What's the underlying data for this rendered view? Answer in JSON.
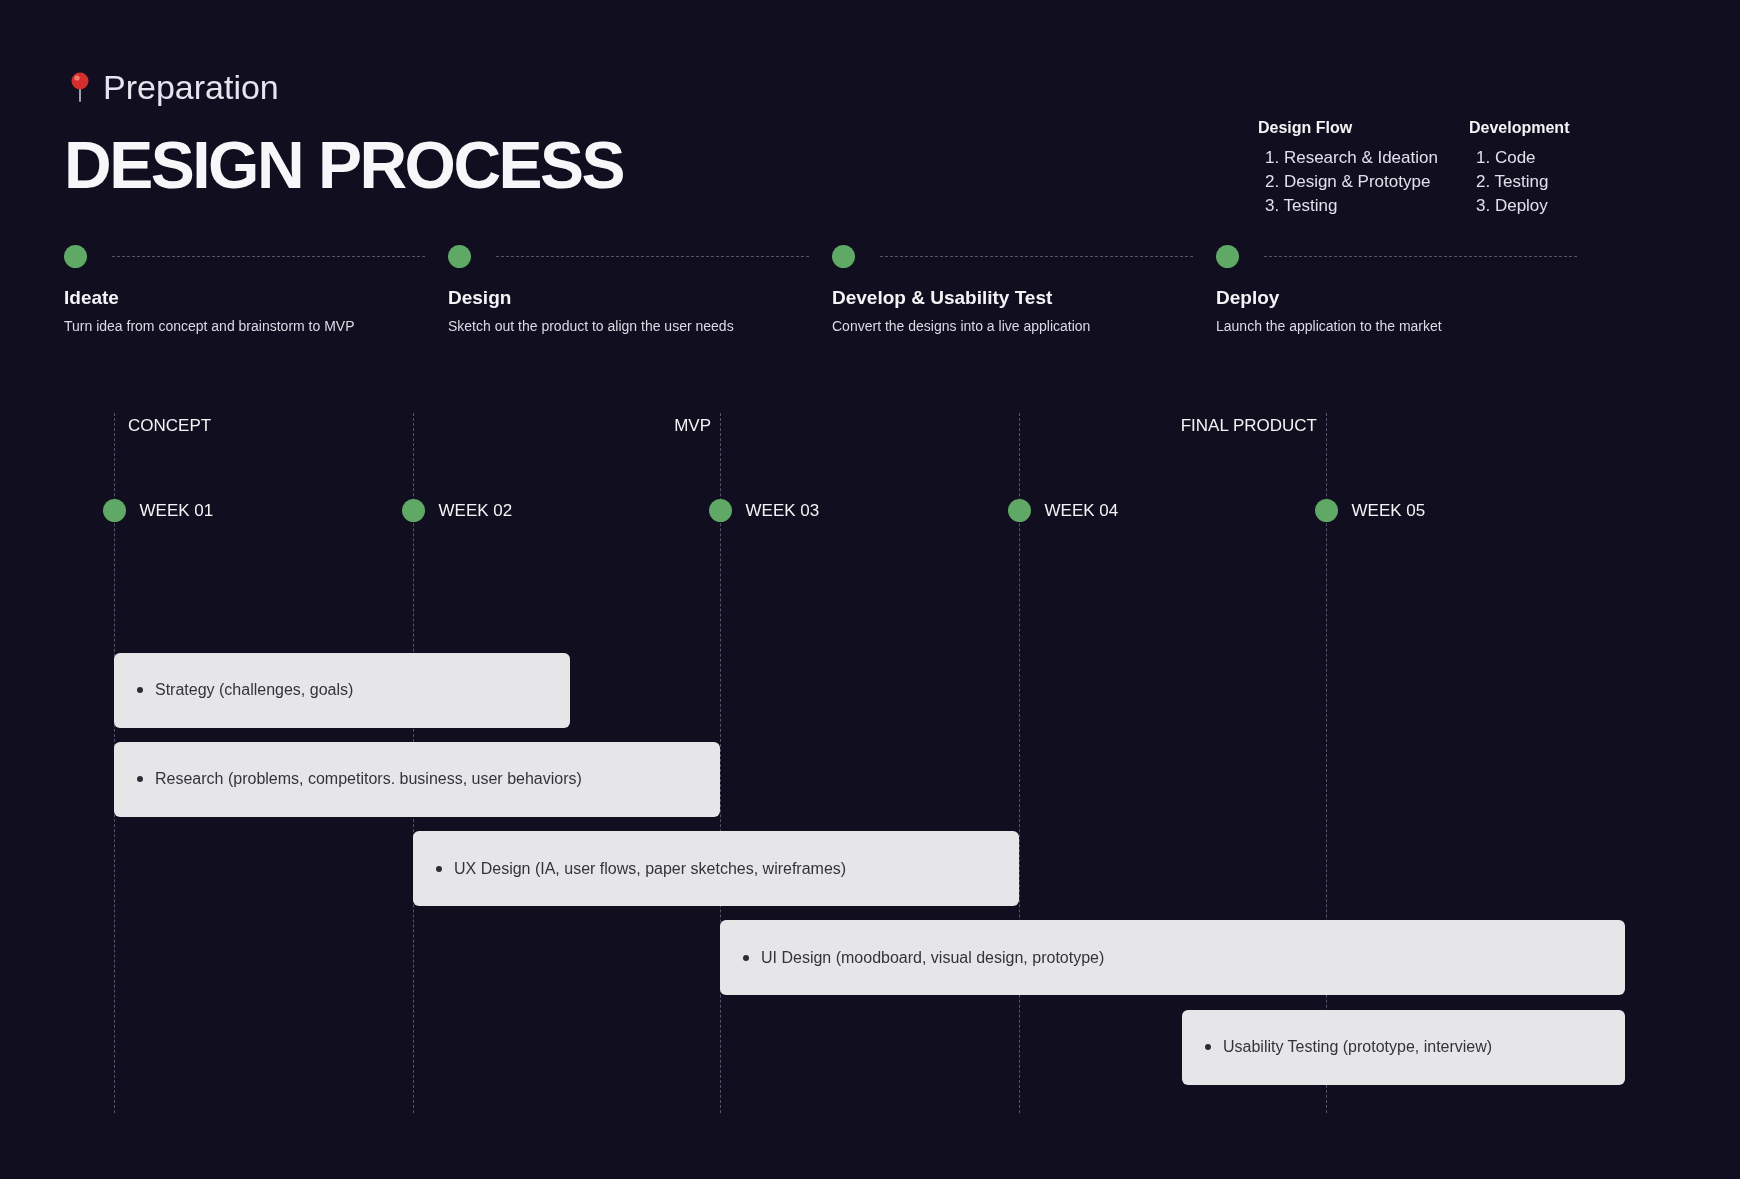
{
  "header": {
    "eyebrow": "Preparation",
    "title": "DESIGN PROCESS"
  },
  "legend": [
    {
      "heading": "Design Flow",
      "items": [
        "1. Research & Ideation",
        "2. Design & Prototype",
        "3. Testing"
      ]
    },
    {
      "heading": "Development",
      "items": [
        "1. Code",
        "2. Testing",
        "3. Deploy"
      ]
    }
  ],
  "phases": [
    {
      "title": "Ideate",
      "description": "Turn idea from concept and brainstorm to MVP"
    },
    {
      "title": "Design",
      "description": "Sketch out the product to align the user needs"
    },
    {
      "title": "Develop & Usability Test",
      "description": "Convert the designs into a live application"
    },
    {
      "title": "Deploy",
      "description": "Launch the application to the market"
    }
  ],
  "timeline": {
    "weeks": [
      {
        "label": "WEEK 01",
        "milestone": "CONCEPT"
      },
      {
        "label": "WEEK 02"
      },
      {
        "label": "WEEK 03",
        "milestone": "MVP"
      },
      {
        "label": "WEEK 04"
      },
      {
        "label": "WEEK 05",
        "milestone": "FINAL PRODUCT"
      }
    ],
    "tasks": [
      "Strategy (challenges, goals)",
      "Research (problems, competitors. business, user behaviors)",
      "UX Design (IA, user flows, paper sketches, wireframes)",
      "UI Design (moodboard, visual design, prototype)",
      "Usability Testing (prototype, interview)"
    ]
  }
}
